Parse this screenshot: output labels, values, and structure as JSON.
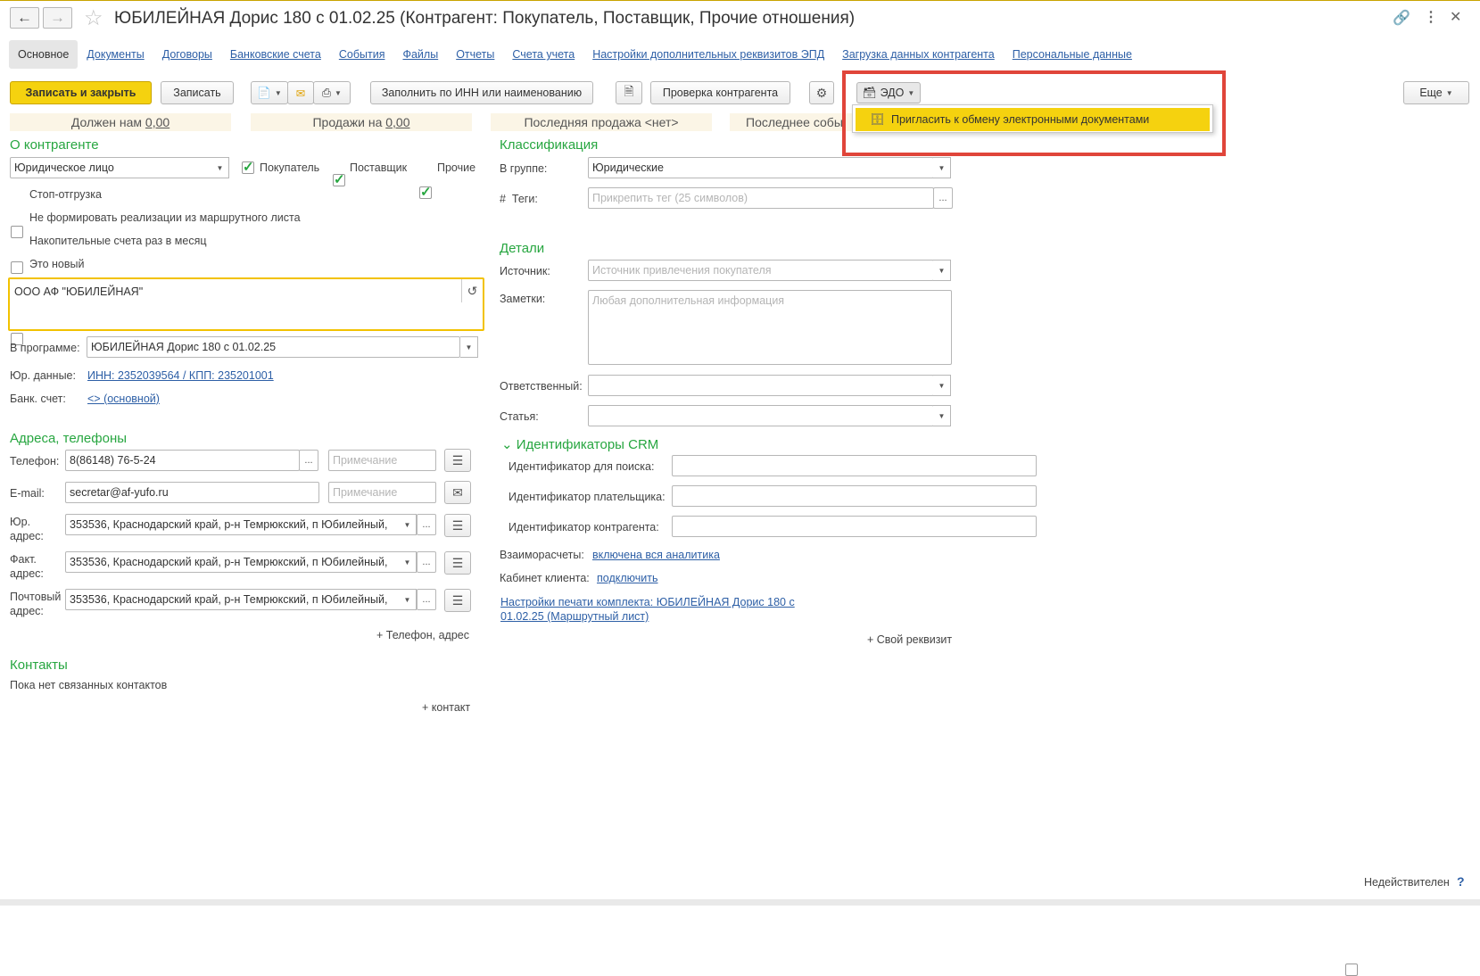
{
  "window": {
    "title": "ЮБИЛЕЙНАЯ Дорис 180  с 01.02.25 (Контрагент: Покупатель, Поставщик, Прочие отношения)"
  },
  "header_icons": {
    "link": "link-icon",
    "more": "more-vertical-icon",
    "close": "close-icon"
  },
  "tabs": [
    {
      "label": "Основное"
    },
    {
      "label": "Документы"
    },
    {
      "label": "Договоры"
    },
    {
      "label": "Банковские счета"
    },
    {
      "label": "События"
    },
    {
      "label": "Файлы"
    },
    {
      "label": "Отчеты"
    },
    {
      "label": "Счета учета"
    },
    {
      "label": "Настройки дополнительных реквизитов ЭПД"
    },
    {
      "label": "Загрузка данных контрагента"
    },
    {
      "label": "Персональные данные"
    }
  ],
  "toolbar": {
    "save_close": "Записать и закрыть",
    "save": "Записать",
    "fill_inn": "Заполнить по ИНН или наименованию",
    "check": "Проверка контрагента",
    "edo": "ЭДО",
    "more": "Еще"
  },
  "edo_menu": {
    "invite": "Пригласить к обмену электронными документами"
  },
  "stats": {
    "owes_label": "Должен нам",
    "owes_value": "0,00",
    "sales_label": "Продажи на",
    "sales_value": "0,00",
    "last_sale": "Последняя продажа <нет>",
    "last_event": "Последнее собы"
  },
  "about": {
    "section": "О контрагенте",
    "type": "Юридическое лицо",
    "buyer": "Покупатель",
    "supplier": "Поставщик",
    "other": "Прочие",
    "stop_ship": "Стоп-отгрузка",
    "no_route": "Не формировать реализации из маршрутного листа",
    "monthly": "Накопительные счета раз в месяц",
    "is_new": "Это новый",
    "full_name": "ООО АФ \"ЮБИЛЕЙНАЯ\"",
    "in_program_label": "В программе:",
    "in_program_value": "ЮБИЛЕЙНАЯ Дорис 180  с 01.02.25",
    "legal_label": "Юр. данные:",
    "legal_value": "ИНН: 2352039564 / КПП: 235201001",
    "bank_label": "Банк. счет:",
    "bank_value": "<> (основной)"
  },
  "addresses": {
    "section": "Адреса, телефоны",
    "phone_label": "Телефон:",
    "phone_value": "8(86148) 76-5-24",
    "note_placeholder": "Примечание",
    "email_label": "E-mail:",
    "email_value": "secretar@af-yufo.ru",
    "legal_addr_label1": "Юр.",
    "legal_addr_label2": "адрес:",
    "fact_addr_label1": "Факт.",
    "fact_addr_label2": "адрес:",
    "post_addr_label1": "Почтовый",
    "post_addr_label2": "адрес:",
    "addr_value": "353536, Краснодарский край, р-н Темрюкский, п Юбилейный,",
    "add_phone": "+ Телефон, адрес"
  },
  "contacts": {
    "section": "Контакты",
    "empty": "Пока нет связанных контактов",
    "add": "+ контакт"
  },
  "classification": {
    "section": "Классификация",
    "group_label": "В группе:",
    "group_value": "Юридические",
    "tags_label": "Теги:",
    "tags_prefix": "#",
    "tags_placeholder": "Прикрепить тег (25 символов)"
  },
  "details": {
    "section": "Детали",
    "source_label": "Источник:",
    "source_placeholder": "Источник привлечения покупателя",
    "notes_label": "Заметки:",
    "notes_placeholder": "Любая дополнительная информация",
    "responsible_label": "Ответственный:",
    "article_label": "Статья:"
  },
  "crm": {
    "section": "Идентификаторы CRM",
    "search_label": "Идентификатор для поиска:",
    "payer_label": "Идентификатор плательщика:",
    "counterparty_label": "Идентификатор контрагента:"
  },
  "extra": {
    "settlements_label": "Взаиморасчеты:",
    "settlements_value": "включена вся аналитика",
    "cabinet_label": "Кабинет клиента:",
    "cabinet_value": "подключить",
    "print_settings_1": "Настройки печати комплекта: ЮБИЛЕЙНАЯ Дорис 180  с",
    "print_settings_2": "01.02.25 (Маршрутный лист)",
    "own_attr": "+ Свой реквизит"
  },
  "footer": {
    "inactive": "Недействителен",
    "help": "?"
  },
  "colors": {
    "accent_yellow": "#f5d20f",
    "section_green": "#27a640",
    "link_blue": "#2d5fa6",
    "highlight_red": "#e0453a"
  }
}
